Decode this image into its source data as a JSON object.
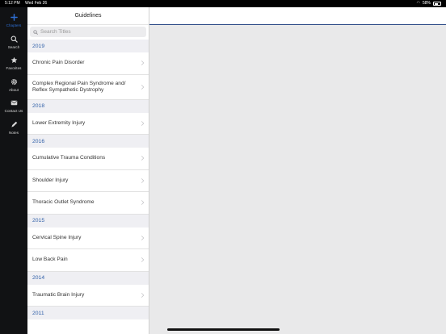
{
  "status": {
    "time": "5:12 PM",
    "date": "Wed Feb 26",
    "battery": "58%"
  },
  "sidebar": {
    "items": [
      {
        "label": "Chapters",
        "icon": "plus-icon",
        "active": true
      },
      {
        "label": "Search",
        "icon": "search-icon",
        "active": false
      },
      {
        "label": "Favorites",
        "icon": "star-icon",
        "active": false
      },
      {
        "label": "About",
        "icon": "gear-icon",
        "active": false
      },
      {
        "label": "Contact Us",
        "icon": "mail-icon",
        "active": false
      },
      {
        "label": "Notes",
        "icon": "pencil-icon",
        "active": false
      }
    ]
  },
  "list": {
    "title": "Guidelines",
    "search_placeholder": "Search Titles",
    "sections": [
      {
        "year": "2019",
        "items": [
          "Chronic Pain Disorder",
          "Complex Regional Pain Syndrome and/ Reflex Sympathetic Dystrophy"
        ]
      },
      {
        "year": "2018",
        "items": [
          "Lower Extremity Injury"
        ]
      },
      {
        "year": "2016",
        "items": [
          "Cumulative Trauma Conditions",
          "Shoulder Injury",
          "Thoracic Outlet Syndrome"
        ]
      },
      {
        "year": "2015",
        "items": [
          "Cervical Spine Injury",
          "Low Back Pain"
        ]
      },
      {
        "year": "2014",
        "items": [
          "Traumatic Brain Injury"
        ]
      },
      {
        "year": "2011",
        "items": []
      }
    ]
  },
  "colors": {
    "accent": "#2f6fd4",
    "section_text": "#2f5fa8",
    "sidebar_bg": "#111214"
  }
}
